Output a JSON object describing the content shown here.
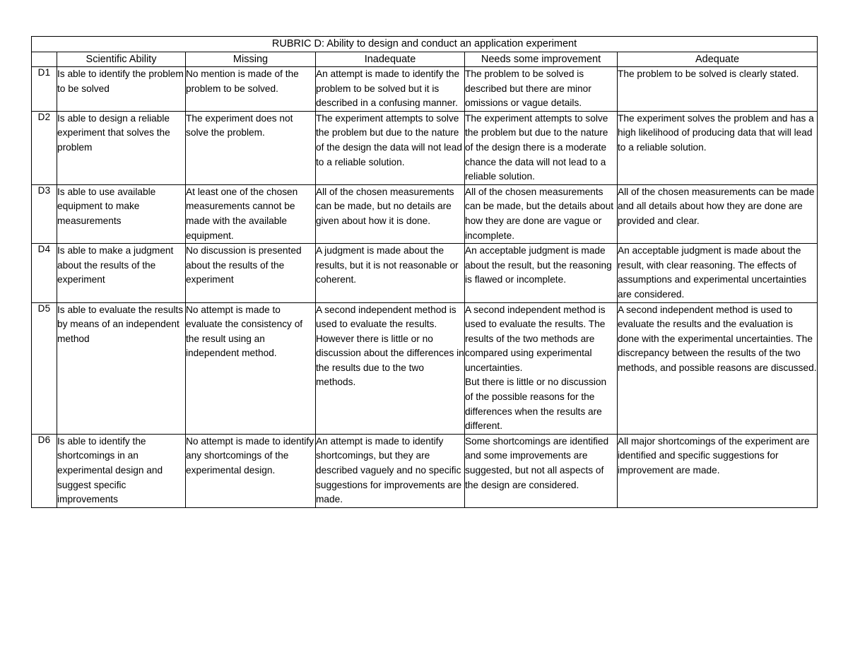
{
  "document": {
    "title": "RUBRIC D: Ability to design and conduct an application experiment"
  },
  "table": {
    "headers": {
      "label": "",
      "ability": "Scientific Ability",
      "missing": "Missing",
      "inadequate": "Inadequate",
      "needs": "Needs some improvement",
      "adequate": "Adequate"
    },
    "rows": [
      {
        "label": "D1",
        "ability": "Is able to identify the problem to be solved",
        "missing": "No mention is made of the problem to be solved.",
        "inadequate": "An attempt is made to identify the problem to be solved but it is described in a confusing manner.",
        "needs": "The problem to be solved is described but there are minor omissions or vague details.",
        "adequate": "The problem to be solved is clearly stated."
      },
      {
        "label": "D2",
        "ability": "Is able to design a reliable experiment that solves the problem",
        "missing": "The experiment does not solve the problem.",
        "inadequate": "The experiment attempts to solve the problem but due to the nature of the design the data will not lead to a reliable solution.",
        "needs": "The experiment attempts to solve the problem but due to the nature of the design there is a moderate chance the data will not lead to a reliable solution.",
        "adequate": "The experiment solves the problem and has a high likelihood of producing data that will lead to a reliable solution."
      },
      {
        "label": "D3",
        "ability": "Is able to use available equipment to make measurements",
        "missing": "At least one of the chosen measurements cannot be made with the available equipment.",
        "inadequate": "All of the chosen measurements can be made, but no details are given about how it is done.",
        "needs": "All of the chosen measurements can be made, but the details about how they are done are vague or incomplete.",
        "adequate": "All of the chosen measurements can be made and all details about how they are done are provided and clear."
      },
      {
        "label": "D4",
        "ability": "Is able to make a judgment about the results of the experiment",
        "missing": "No discussion is presented about the results of the experiment",
        "inadequate": "A judgment is made about the results, but it is not reasonable or coherent.",
        "needs": "An acceptable judgment is made about the result, but the reasoning is flawed or incomplete.",
        "adequate": "An acceptable judgment is made about the result, with clear reasoning. The effects of assumptions and experimental uncertainties are considered."
      },
      {
        "label": "D5",
        "ability": "Is able to evaluate the results by means of an independent method",
        "missing": "No attempt is made to evaluate the consistency of the result using an independent method.",
        "inadequate": "A second independent method is used to evaluate the results.\nHowever there is little or no discussion about the differences in the results due to the two methods.",
        "needs": "A second independent method is used to evaluate the results. The results of the two methods are compared using experimental uncertainties.\nBut there is little or no discussion of the possible reasons for the differences when the results are different.",
        "adequate": "A second independent method is used to evaluate the results and the evaluation is done with the experimental uncertainties. The discrepancy between the results of the two methods, and possible reasons are discussed."
      },
      {
        "label": "D6",
        "ability": "Is able to identify the shortcomings in an experimental design and suggest specific improvements",
        "missing": "No attempt is made to identify any shortcomings of the experimental design.",
        "inadequate": "An attempt is made to identify shortcomings, but they are described vaguely and no specific suggestions for improvements are made.",
        "needs": "Some shortcomings are identified and some improvements are suggested, but not all aspects of the design are considered.",
        "adequate": "All major shortcomings of the experiment are identified and specific suggestions for improvement are made."
      }
    ]
  }
}
